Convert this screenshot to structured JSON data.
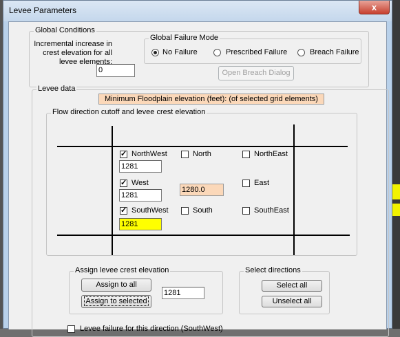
{
  "window": {
    "title": "Levee Parameters",
    "close_glyph": "x"
  },
  "global_conditions": {
    "legend": "Global Conditions",
    "increment_label": "Incremental increase in crest elevation for all levee elements:",
    "increment_value": "0"
  },
  "failure_mode": {
    "legend": "Global Failure Mode",
    "options": [
      "No Failure",
      "Prescribed Failure",
      "Breach Failure"
    ],
    "selected": "No Failure",
    "open_breach_label": "Open Breach Dialog"
  },
  "levee_data": {
    "legend": "Levee data",
    "min_floodplain_text": "Minimum Floodplain elevation (feet): (of selected grid elements)"
  },
  "flow_direction": {
    "legend": "Flow direction cutoff and levee crest elevation",
    "cells": {
      "northwest": {
        "label": "NorthWest",
        "checked": true,
        "value": "1281"
      },
      "north": {
        "label": "North",
        "checked": false
      },
      "northeast": {
        "label": "NorthEast",
        "checked": false
      },
      "west": {
        "label": "West",
        "checked": true,
        "value": "1281"
      },
      "center": {
        "value": "1280.0"
      },
      "east": {
        "label": "East",
        "checked": false
      },
      "southwest": {
        "label": "SouthWest",
        "checked": true,
        "value": "1281"
      },
      "south": {
        "label": "South",
        "checked": false
      },
      "southeast": {
        "label": "SouthEast",
        "checked": false
      }
    }
  },
  "assign": {
    "legend": "Assign levee crest elevation",
    "assign_all_label": "Assign to all",
    "assign_selected_label": "Assign to selected",
    "value": "1281"
  },
  "select_directions": {
    "legend": "Select directions",
    "select_all_label": "Select all",
    "unselect_all_label": "Unselect all"
  },
  "bottom_check": {
    "label": "Levee failure for this direction (SouthWest)"
  },
  "colors": {
    "readonly_bg": "#fbd8b9",
    "highlight": "#ffff00",
    "window_frame": "#b9d1ea"
  }
}
